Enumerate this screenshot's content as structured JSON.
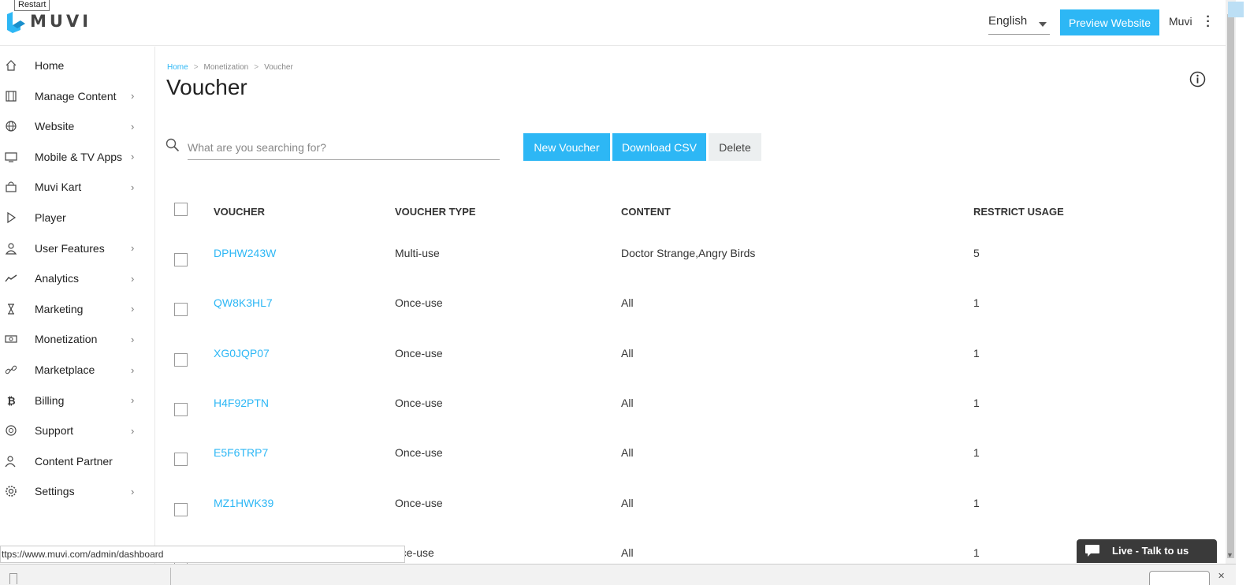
{
  "header": {
    "logo_text": "MUVI",
    "tooltip": "Restart",
    "language": "English",
    "preview_button": "Preview Website",
    "user": "Muvi"
  },
  "sidebar": {
    "items": [
      {
        "label": "Home",
        "icon": "home-icon",
        "chevron": false
      },
      {
        "label": "Manage Content",
        "icon": "film-icon",
        "chevron": true
      },
      {
        "label": "Website",
        "icon": "globe-icon",
        "chevron": true
      },
      {
        "label": "Mobile & TV Apps",
        "icon": "monitor-icon",
        "chevron": true
      },
      {
        "label": "Muvi Kart",
        "icon": "shopping-bag-icon",
        "chevron": true
      },
      {
        "label": "Player",
        "icon": "play-icon",
        "chevron": false
      },
      {
        "label": "User Features",
        "icon": "user-icon",
        "chevron": true
      },
      {
        "label": "Analytics",
        "icon": "trend-line-icon",
        "chevron": true
      },
      {
        "label": "Marketing",
        "icon": "hourglass-icon",
        "chevron": true
      },
      {
        "label": "Monetization",
        "icon": "banknote-icon",
        "chevron": true
      },
      {
        "label": "Marketplace",
        "icon": "link-icon",
        "chevron": true
      },
      {
        "label": "Billing",
        "icon": "bitcoin-icon",
        "chevron": true
      },
      {
        "label": "Support",
        "icon": "lifebuoy-icon",
        "chevron": true
      },
      {
        "label": "Content Partner",
        "icon": "partner-icon",
        "chevron": false
      },
      {
        "label": "Settings",
        "icon": "gear-icon",
        "chevron": true
      }
    ]
  },
  "breadcrumb": {
    "home": "Home",
    "sep": ">",
    "section": "Monetization",
    "current": "Voucher"
  },
  "page_title": "Voucher",
  "search": {
    "placeholder": "What are you searching for?",
    "value": ""
  },
  "toolbar": {
    "new_voucher": "New Voucher",
    "download_csv": "Download CSV",
    "delete": "Delete"
  },
  "table": {
    "columns": [
      "VOUCHER",
      "VOUCHER TYPE",
      "CONTENT",
      "RESTRICT USAGE"
    ],
    "rows": [
      {
        "voucher": "DPHW243W",
        "type": "Multi-use",
        "content": "Doctor Strange,Angry Birds",
        "restrict": "5"
      },
      {
        "voucher": "QW8K3HL7",
        "type": "Once-use",
        "content": "All",
        "restrict": "1"
      },
      {
        "voucher": "XG0JQP07",
        "type": "Once-use",
        "content": "All",
        "restrict": "1"
      },
      {
        "voucher": "H4F92PTN",
        "type": "Once-use",
        "content": "All",
        "restrict": "1"
      },
      {
        "voucher": "E5F6TRP7",
        "type": "Once-use",
        "content": "All",
        "restrict": "1"
      },
      {
        "voucher": "MZ1HWK39",
        "type": "Once-use",
        "content": "All",
        "restrict": "1"
      },
      {
        "voucher": "",
        "type": "nce-use",
        "content": "All",
        "restrict": "1"
      }
    ]
  },
  "status_bar": {
    "url": "ttps://www.muvi.com/admin/dashboard"
  },
  "live_chat": {
    "label": "Live - Talk to us"
  },
  "colors": {
    "accent": "#2db7f5",
    "chat_bg": "#3a3a3a"
  }
}
